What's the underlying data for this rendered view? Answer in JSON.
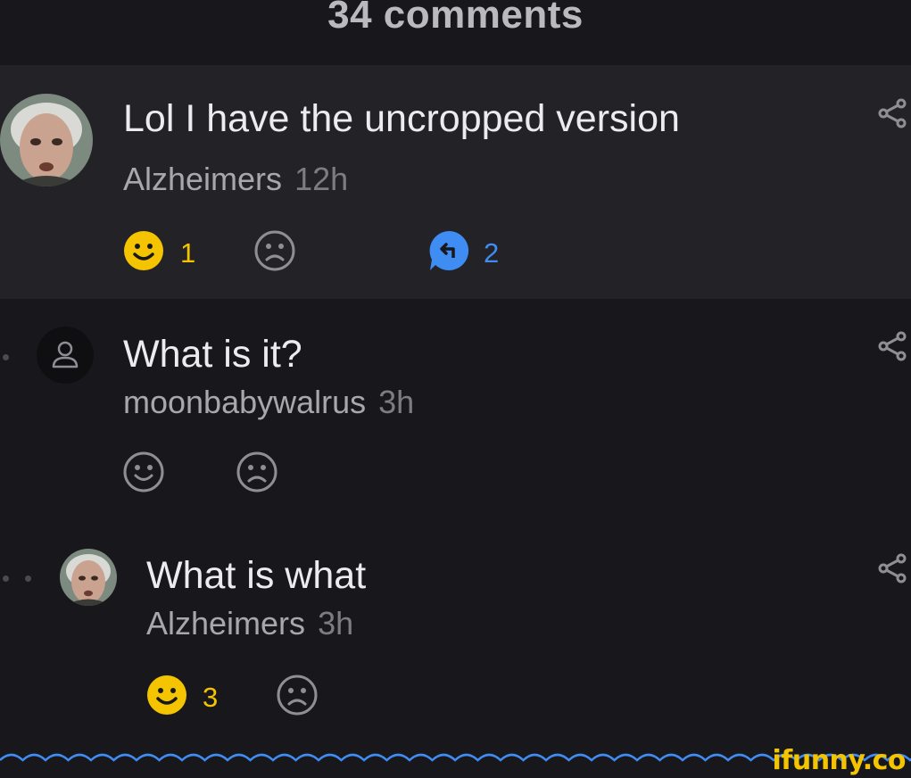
{
  "header": {
    "title": "34 comments"
  },
  "comments": [
    {
      "text": "Lol I have the uncropped version",
      "author": "Alzheimers",
      "time": "12h",
      "smile_count": "1",
      "reply_count": "2"
    },
    {
      "text": "What is it?",
      "author": "moonbabywalrus",
      "time": "3h"
    },
    {
      "text": "What is what",
      "author": "Alzheimers",
      "time": "3h",
      "smile_count": "3"
    }
  ],
  "branding": {
    "logo_text": "ifunny.co"
  },
  "colors": {
    "background": "#18181c",
    "highlight": "#232327",
    "accent_yellow": "#f5c400",
    "accent_blue": "#3f8cf2"
  },
  "icons": [
    "smile-icon",
    "frown-icon",
    "reply-icon",
    "share-icon",
    "default-avatar-icon"
  ]
}
